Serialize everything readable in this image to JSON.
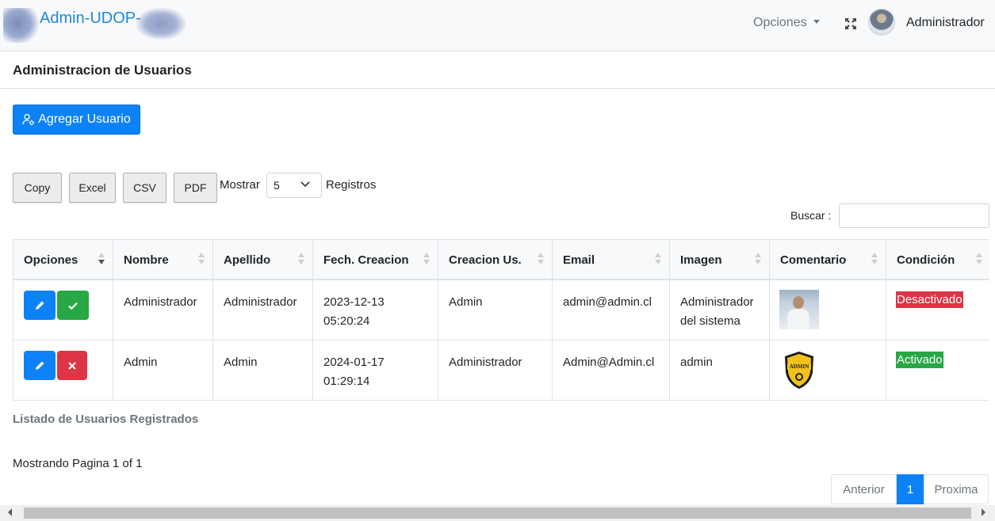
{
  "navbar": {
    "brand": "Admin-UDOP-",
    "options_label": "Opciones",
    "user_name": "Administrador"
  },
  "page": {
    "title": "Administracion de Usuarios",
    "add_button": "Agregar Usuario"
  },
  "toolbar": {
    "buttons": [
      "Copy",
      "Excel",
      "CSV",
      "PDF"
    ],
    "show_label": "Mostrar",
    "page_size": "5",
    "records_label": "Registros",
    "search_label": "Buscar :",
    "search_value": ""
  },
  "table": {
    "columns": [
      "Opciones",
      "Nombre",
      "Apellido",
      "Fech. Creacion",
      "Creacion Us.",
      "Email",
      "Imagen",
      "Comentario",
      "Condición"
    ],
    "rows": [
      {
        "nombre": "Administrador",
        "apellido": "Administrador",
        "fecha_1": "2023-12-13",
        "fecha_2": "05:20:24",
        "creacion": "Admin",
        "email": "admin@admin.cl",
        "imagen_1": "Administrador",
        "imagen_2": "del sistema",
        "comentario_img": "user-photo",
        "condicion": "Desactivado",
        "condicion_color": "#dc3545",
        "action_2": "check-icon"
      },
      {
        "nombre": "Admin",
        "apellido": "Admin",
        "fecha_1": "2024-01-17",
        "fecha_2": "01:29:14",
        "creacion": "Administrador",
        "email": "Admin@Admin.cl",
        "imagen_1": "admin",
        "imagen_2": "",
        "comentario_img": "admin-shield",
        "condicion": "Activado",
        "condicion_color": "#28a745",
        "action_2": "x-icon"
      }
    ],
    "caption": "Listado de Usuarios Registrados"
  },
  "pagination": {
    "info": "Mostrando Pagina 1 of 1",
    "prev": "Anterior",
    "current": "1",
    "next": "Proxima"
  },
  "colors": {
    "primary": "#0d82f7",
    "success": "#28a745",
    "danger": "#dc3545"
  }
}
